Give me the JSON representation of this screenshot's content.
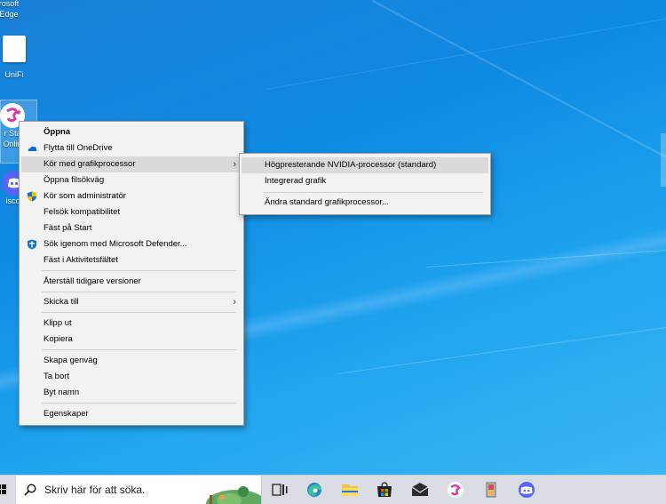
{
  "desktop": {
    "icons": [
      {
        "label_line1": "rosoft",
        "label_line2": "Edge"
      },
      {
        "label_line1": "UniFi"
      },
      {
        "label_line1": "r Sta",
        "label_line2": "Onlin"
      },
      {
        "label_line1": "iscor"
      }
    ]
  },
  "context_menu": {
    "items": [
      {
        "label": "Öppna",
        "bold": true
      },
      {
        "label": "Flytta till OneDrive",
        "icon": "onedrive-icon"
      },
      {
        "label": "Kör med grafikprocessor",
        "has_submenu": true,
        "highlighted": true
      },
      {
        "label": "Öppna filsökväg"
      },
      {
        "label": "Kör som administratör",
        "icon": "uac-shield-icon"
      },
      {
        "label": "Felsök kompatibilitet"
      },
      {
        "label": "Fäst på Start"
      },
      {
        "label": "Sök igenom med Microsoft Defender...",
        "icon": "defender-icon"
      },
      {
        "label": "Fäst i Aktivitetsfältet"
      },
      {
        "label": "Återställ tidigare versioner"
      },
      {
        "label": "Skicka till",
        "has_submenu": true
      },
      {
        "label": "Klipp ut"
      },
      {
        "label": "Kopiera"
      },
      {
        "label": "Skapa genväg"
      },
      {
        "label": "Ta bort"
      },
      {
        "label": "Byt namn"
      },
      {
        "label": "Egenskaper"
      }
    ]
  },
  "submenu": {
    "items": [
      {
        "label": "Högpresterande NVIDIA-processor (standard)",
        "highlighted": true
      },
      {
        "label": "Integrerad grafik"
      },
      {
        "label": "Ändra standard grafikprocessor..."
      }
    ]
  },
  "taskbar": {
    "search_placeholder": "Skriv här för att söka.",
    "apps": [
      "task-view-icon",
      "edge-icon",
      "file-explorer-icon",
      "store-icon",
      "mail-icon",
      "star-stable-icon",
      "app-icon",
      "discord-icon"
    ]
  },
  "colors": {
    "desktop": "#0f8ae3",
    "menu_bg": "#f2f2f2",
    "highlight": "#dadada",
    "taskbar": "#d9dde3"
  }
}
